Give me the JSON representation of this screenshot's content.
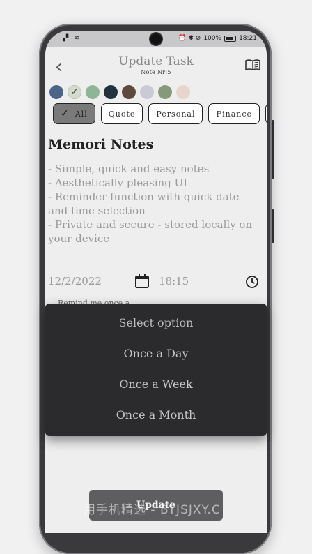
{
  "statusbar": {
    "signal": "▗▘ ≋",
    "icons": "⏰ ✱ ⊘",
    "battery_pct": "100%",
    "time": "18:21"
  },
  "header": {
    "title": "Update Task",
    "subtitle": "Note Nr:5",
    "back_icon": "chevron-left-icon",
    "book_icon": "book-icon"
  },
  "swatches": [
    {
      "color": "#4c6488",
      "selected": false
    },
    {
      "color": "#d4dcd0",
      "selected": true,
      "mark": "✓"
    },
    {
      "color": "#8db596",
      "selected": false
    },
    {
      "color": "#243240",
      "selected": false
    },
    {
      "color": "#5e4b3d",
      "selected": false
    },
    {
      "color": "#c9cad6",
      "selected": false
    },
    {
      "color": "#869a7b",
      "selected": false
    },
    {
      "color": "#e7d5cc",
      "selected": false
    }
  ],
  "chips": [
    {
      "label": "All",
      "active": true,
      "mark": "✓"
    },
    {
      "label": "Quote",
      "active": false
    },
    {
      "label": "Personal",
      "active": false
    },
    {
      "label": "Finance",
      "active": false
    },
    {
      "label": "",
      "active": false
    }
  ],
  "note": {
    "title": "Memori Notes",
    "body": "- Simple, quick and easy notes\n- Aesthetically pleasing UI\n- Reminder function with quick date and time selection\n- Private and secure - stored locally on your device"
  },
  "reminder": {
    "date": "12/2/2022",
    "time": "18:15",
    "repeat_label": "Remind me once a..."
  },
  "modal": {
    "title": "Select option",
    "options": [
      "Once a Day",
      "Once a Week",
      "Once a Month"
    ]
  },
  "footer": {
    "update_label": "Update",
    "watermark": "用手机精选 - BYJSJXY.C"
  }
}
